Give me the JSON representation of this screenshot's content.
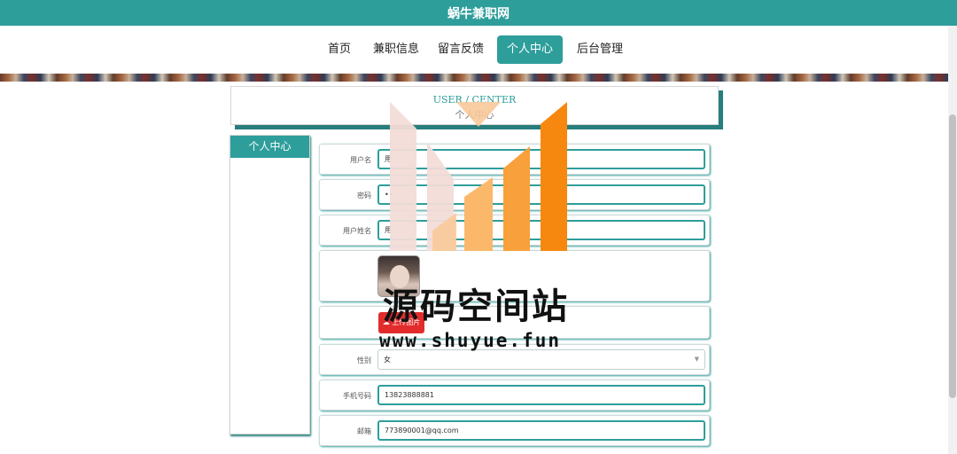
{
  "site": {
    "title": "蜗牛兼职网"
  },
  "nav": {
    "items": [
      {
        "label": "首页"
      },
      {
        "label": "兼职信息"
      },
      {
        "label": "留言反馈"
      },
      {
        "label": "个人中心"
      },
      {
        "label": "后台管理"
      }
    ],
    "active": "个人中心"
  },
  "user_center": {
    "title_en": "USER / CENTER",
    "title_cn": "个人中心"
  },
  "sidebar": {
    "header": "个人中心"
  },
  "form": {
    "username": {
      "label": "用户名",
      "value": "用"
    },
    "password": {
      "label": "密码",
      "value": "••"
    },
    "real_name": {
      "label": "用户姓名",
      "value": "用"
    },
    "upload_label": "上传图片",
    "gender": {
      "label": "性别",
      "value": "女"
    },
    "phone": {
      "label": "手机号码",
      "value": "13823888881"
    },
    "email": {
      "label": "邮箱",
      "value": "773890001@qq.com"
    }
  },
  "watermark": {
    "text": "源码空间站",
    "url": "www.shuyue.fun"
  },
  "colors": {
    "accent": "#2e9e9b",
    "upload": "#e22c2c",
    "watermark_orange": "#f7880f"
  }
}
